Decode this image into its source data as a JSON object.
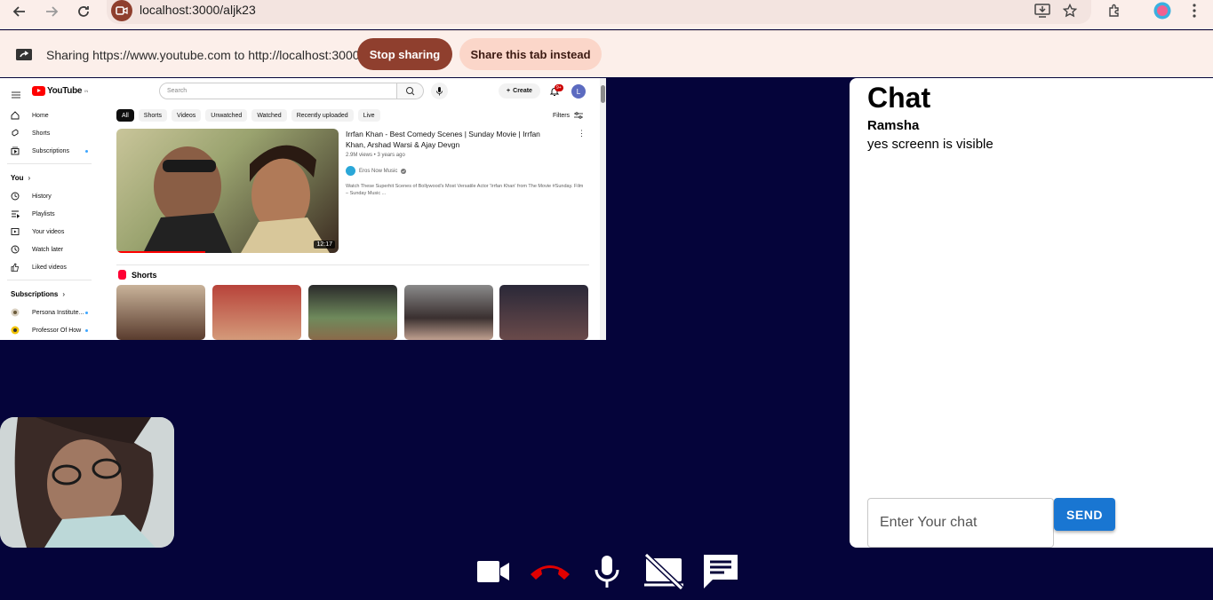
{
  "browser": {
    "url": "localhost:3000/aljk23"
  },
  "share_bar": {
    "message": "Sharing https://www.youtube.com to http://localhost:3000",
    "stop_label": "Stop sharing",
    "switch_label": "Share this tab instead"
  },
  "youtube": {
    "logo_text": "YouTube",
    "region": "IN",
    "search_placeholder": "Search",
    "create_label": "Create",
    "notification_count": "9+",
    "avatar_letter": "L",
    "sidebar": {
      "main": [
        "Home",
        "Shorts",
        "Subscriptions"
      ],
      "you_heading": "You",
      "you_items": [
        "History",
        "Playlists",
        "Your videos",
        "Watch later",
        "Liked videos"
      ],
      "subs_heading": "Subscriptions",
      "subs_items": [
        "Persona Institute...",
        "Professor Of How"
      ]
    },
    "chips": [
      "All",
      "Shorts",
      "Videos",
      "Unwatched",
      "Watched",
      "Recently uploaded",
      "Live"
    ],
    "filters_label": "Filters",
    "video": {
      "title": "Irrfan Khan - Best Comedy Scenes | Sunday Movie | Irrfan Khan, Arshad Warsi & Ajay Devgn",
      "meta": "2.9M views • 3 years ago",
      "channel": "Eros Now Music",
      "description": "Watch These Superhit Scenes of Bollywood's Most Versatile Actor 'Irrfan Khan' from The Movie #Sunday. Film – Sunday Music ...",
      "duration": "12:17"
    },
    "shorts_heading": "Shorts"
  },
  "chat": {
    "title": "Chat",
    "messages": [
      {
        "user": "Ramsha",
        "text": "yes screenn is visible"
      }
    ],
    "input_placeholder": "Enter Your chat",
    "send_label": "SEND"
  },
  "controls": [
    "camera-icon",
    "end-call-icon",
    "microphone-icon",
    "screen-share-off-icon",
    "chat-icon"
  ],
  "colors": {
    "background": "#05043a",
    "stop_button": "#8f3f2e",
    "send_button": "#1976d2",
    "end_call": "#e00000"
  }
}
